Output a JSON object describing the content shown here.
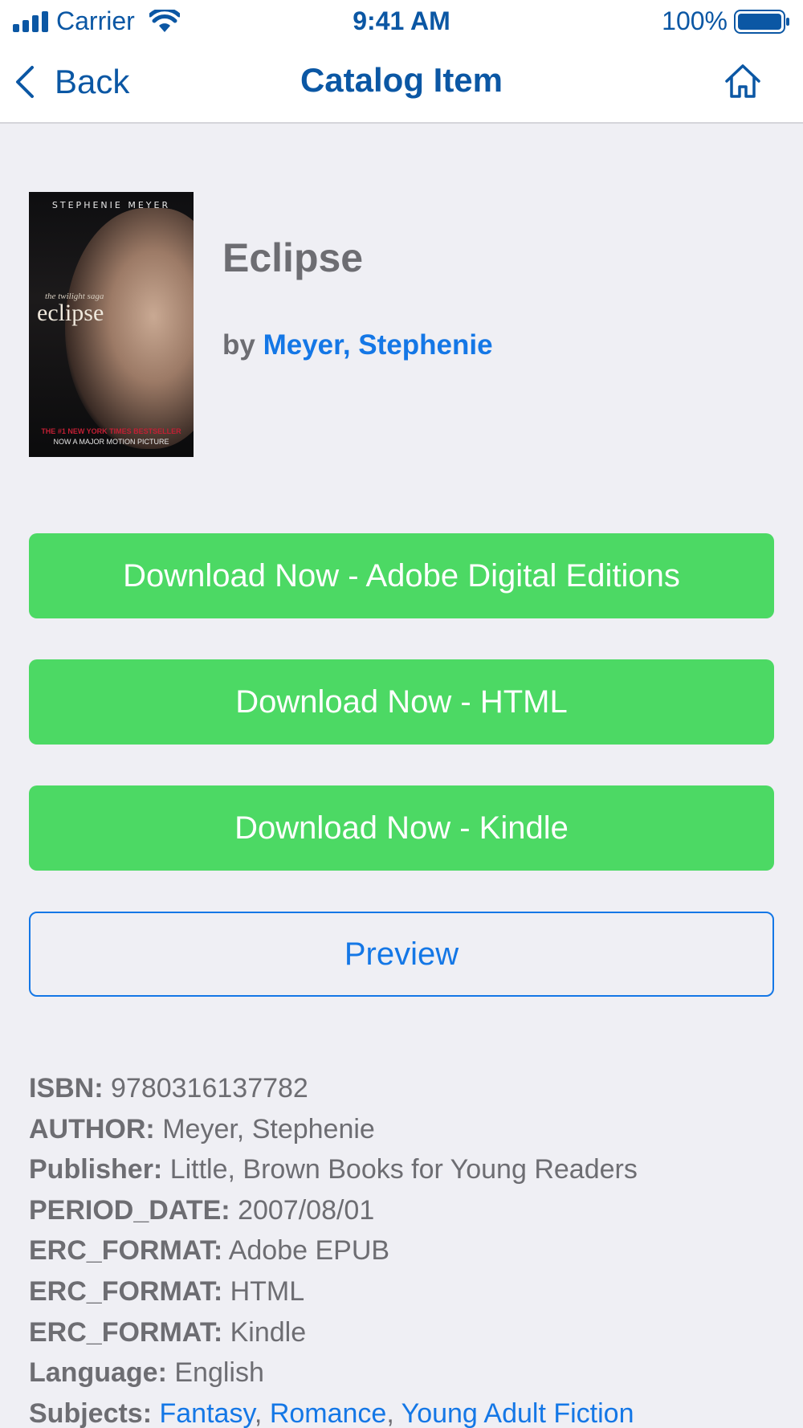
{
  "status_bar": {
    "carrier": "Carrier",
    "time": "9:41 AM",
    "battery": "100%"
  },
  "nav": {
    "back_label": "Back",
    "title": "Catalog Item",
    "home_icon": "home-icon"
  },
  "cover": {
    "author_top": "STEPHENIE MEYER",
    "saga": "the twilight saga",
    "title": "eclipse",
    "bestseller_line": "THE #1 NEW YORK TIMES BESTSELLER",
    "tagline": "NOW A MAJOR MOTION PICTURE"
  },
  "book": {
    "title": "Eclipse",
    "by_label": "by",
    "author": "Meyer, Stephenie"
  },
  "buttons": {
    "download_ade": "Download Now - Adobe Digital Editions",
    "download_html": "Download Now - HTML",
    "download_kindle": "Download Now - Kindle",
    "preview": "Preview"
  },
  "metadata": {
    "isbn": {
      "key": "ISBN:",
      "value": "9780316137782"
    },
    "author": {
      "key": "AUTHOR:",
      "value": "Meyer, Stephenie"
    },
    "publisher": {
      "key": "Publisher:",
      "value": "Little, Brown Books for Young Readers"
    },
    "period_date": {
      "key": "PERIOD_DATE:",
      "value": "2007/08/01"
    },
    "format_1": {
      "key": "ERC_FORMAT:",
      "value": "Adobe EPUB"
    },
    "format_2": {
      "key": "ERC_FORMAT:",
      "value": "HTML"
    },
    "format_3": {
      "key": "ERC_FORMAT:",
      "value": "Kindle"
    },
    "language": {
      "key": "Language:",
      "value": "English"
    },
    "subjects": {
      "key": "Subjects:",
      "items": [
        "Fantasy",
        "Romance",
        "Young Adult Fiction"
      ],
      "separator": ","
    }
  },
  "colors": {
    "accent": "#1477e6",
    "nav": "#0b57a4",
    "button_green": "#4cd964",
    "background": "#efeff4"
  }
}
